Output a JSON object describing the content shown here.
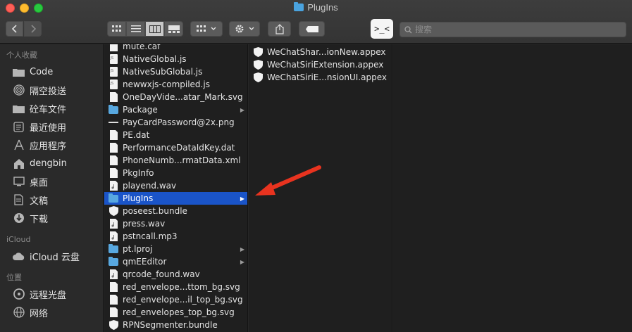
{
  "window": {
    "title": "PlugIns"
  },
  "toolbar": {
    "back_icon": "chevron-left",
    "forward_icon": "chevron-right",
    "view_modes": [
      "icon-view",
      "list-view",
      "column-view",
      "gallery-view"
    ],
    "active_view": "column-view",
    "terminal_label": ">_<",
    "search_placeholder": "搜索"
  },
  "sidebar": {
    "sections": [
      {
        "title": "个人收藏",
        "items": [
          {
            "label": "Code",
            "icon": "folder-icon"
          },
          {
            "label": "隔空投送",
            "icon": "airdrop-icon"
          },
          {
            "label": "砼车文件",
            "icon": "folder-icon"
          },
          {
            "label": "最近使用",
            "icon": "recents-icon"
          },
          {
            "label": "应用程序",
            "icon": "applications-icon"
          },
          {
            "label": "dengbin",
            "icon": "home-icon"
          },
          {
            "label": "桌面",
            "icon": "desktop-icon"
          },
          {
            "label": "文稿",
            "icon": "documents-icon"
          },
          {
            "label": "下载",
            "icon": "downloads-icon"
          }
        ]
      },
      {
        "title": "iCloud",
        "items": [
          {
            "label": "iCloud 云盘",
            "icon": "cloud-icon"
          }
        ]
      },
      {
        "title": "位置",
        "items": [
          {
            "label": "远程光盘",
            "icon": "disc-icon"
          },
          {
            "label": "网络",
            "icon": "network-icon"
          }
        ]
      }
    ]
  },
  "column1": {
    "items": [
      {
        "name": "mute.caf",
        "kind": "file"
      },
      {
        "name": "NativeGlobal.js",
        "kind": "js"
      },
      {
        "name": "NativeSubGlobal.js",
        "kind": "js"
      },
      {
        "name": "newwxjs-compiled.js",
        "kind": "js"
      },
      {
        "name": "OneDayVide...atar_Mark.svg",
        "kind": "file"
      },
      {
        "name": "Package",
        "kind": "folder"
      },
      {
        "name": "PayCardPassword@2x.png",
        "kind": "image"
      },
      {
        "name": "PE.dat",
        "kind": "file"
      },
      {
        "name": "PerformanceDataIdKey.dat",
        "kind": "file"
      },
      {
        "name": "PhoneNumb...rmatData.xml",
        "kind": "file"
      },
      {
        "name": "PkgInfo",
        "kind": "file"
      },
      {
        "name": "playend.wav",
        "kind": "audio"
      },
      {
        "name": "PlugIns",
        "kind": "folder",
        "selected": true
      },
      {
        "name": "poseest.bundle",
        "kind": "bundle"
      },
      {
        "name": "press.wav",
        "kind": "audio"
      },
      {
        "name": "pstncall.mp3",
        "kind": "audio"
      },
      {
        "name": "pt.lproj",
        "kind": "folder"
      },
      {
        "name": "qmEEditor",
        "kind": "folder"
      },
      {
        "name": "qrcode_found.wav",
        "kind": "audio"
      },
      {
        "name": "red_envelope...ttom_bg.svg",
        "kind": "file"
      },
      {
        "name": "red_envelope...il_top_bg.svg",
        "kind": "file"
      },
      {
        "name": "red_envelopes_top_bg.svg",
        "kind": "file"
      },
      {
        "name": "RPNSegmenter.bundle",
        "kind": "bundle"
      }
    ]
  },
  "column2": {
    "items": [
      {
        "name": "WeChatShar...ionNew.appex",
        "kind": "bundle"
      },
      {
        "name": "WeChatSiriExtension.appex",
        "kind": "bundle"
      },
      {
        "name": "WeChatSiriE...nsionUI.appex",
        "kind": "bundle"
      }
    ]
  },
  "colors": {
    "selection": "#1a54c8",
    "folder": "#58a8e0",
    "annotation_arrow": "#e8331f"
  }
}
